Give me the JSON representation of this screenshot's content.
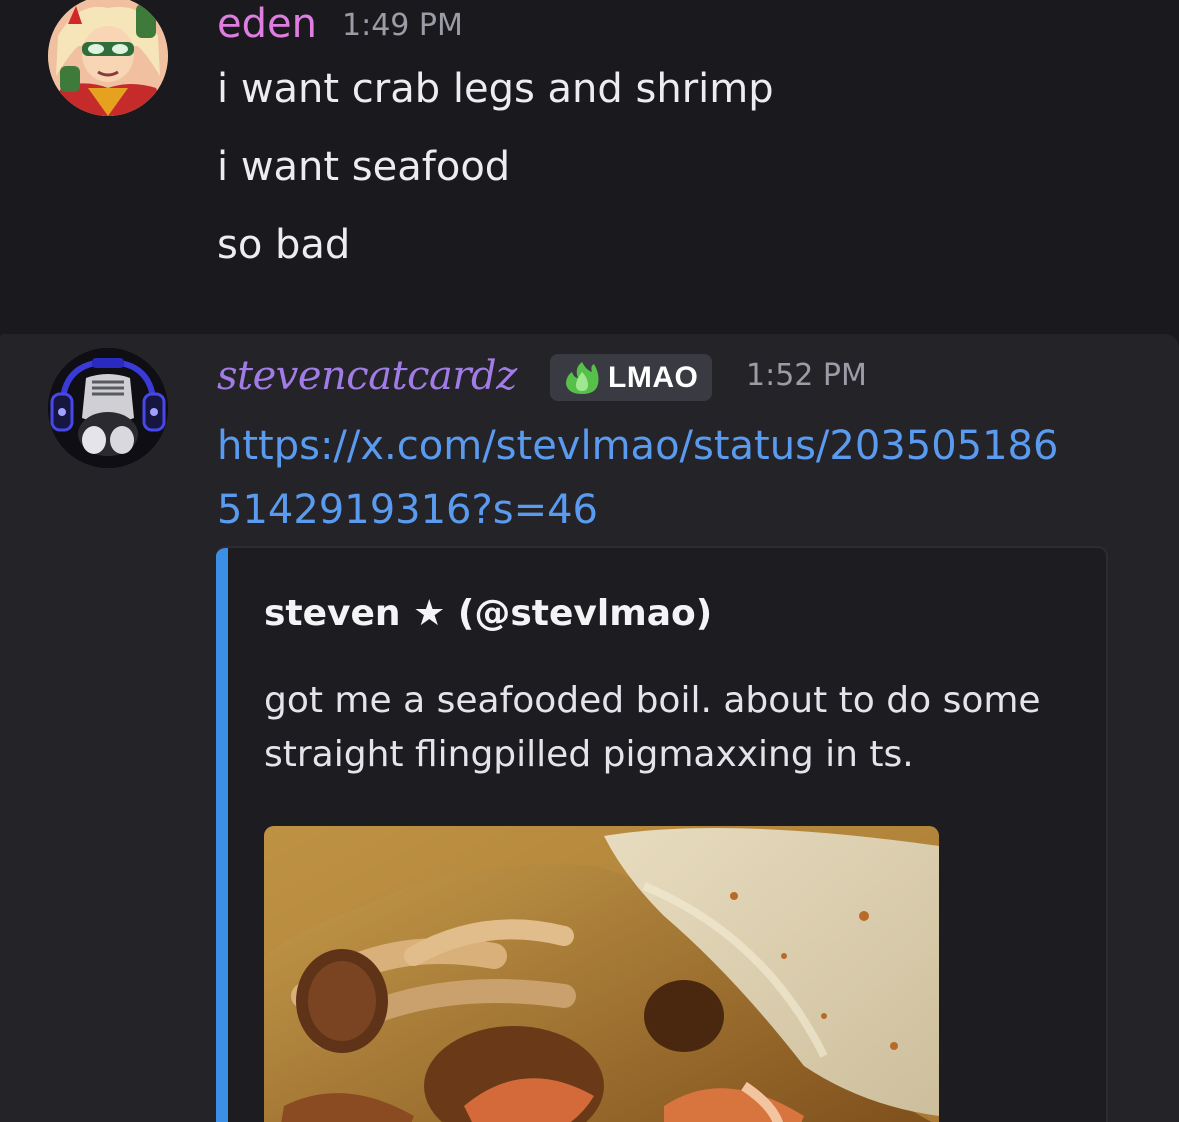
{
  "messages": [
    {
      "username": "eden",
      "timestamp": "1:49 PM",
      "avatar_icon": "avatar-anime-character",
      "lines": [
        "i want crab legs and shrimp",
        "i want seafood",
        "so bad"
      ]
    },
    {
      "username": "stevencatcardz",
      "timestamp": "1:52 PM",
      "avatar_icon": "avatar-cat-headphones",
      "tag": {
        "icon": "green-flame-icon",
        "label": "LMAO"
      },
      "link_lines": [
        "https://x.com/stevlmao/status/203505186",
        "5142919316?s=46"
      ],
      "embed": {
        "author": "steven ★ (@stevlmao)",
        "text_lines": [
          "got me a seafooded boil. about to do some",
          "straight flingpilled pigmaxxing in ts."
        ],
        "image_icon": "seafood-boil-photo"
      }
    }
  ],
  "colors": {
    "background": "#1a1a1e",
    "hover_background": "#232328",
    "eden_name": "#e07de0",
    "steven_name": "#a27ce6",
    "link": "#5a9bf0",
    "embed_accent": "#3b8fe6"
  }
}
